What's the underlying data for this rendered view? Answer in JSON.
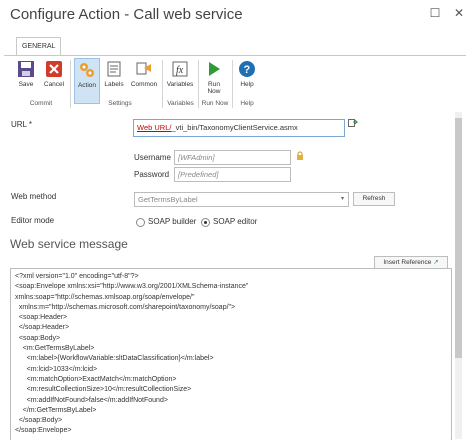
{
  "window": {
    "title": "Configure Action - Call web service",
    "maximize_glyph": "☐",
    "close_glyph": "✕"
  },
  "ribbon": {
    "tab": "GENERAL",
    "buttons": {
      "save": "Save",
      "cancel": "Cancel",
      "action": "Action",
      "labels": "Labels",
      "common": "Common",
      "variables": "Variables",
      "run_now_1": "Run",
      "run_now_2": "Now",
      "help": "Help"
    },
    "groups": {
      "commit": "Commit",
      "settings": "Settings",
      "variables": "Variables",
      "run_now": "Run Now",
      "help": "Help"
    }
  },
  "form": {
    "url_label": "URL *",
    "url_link": "Web URL/",
    "url_rest": "_vti_bin/TaxonomyClientService.asmx",
    "username_label": "Username",
    "username_value": "[WFAdmin]",
    "password_label": "Password",
    "password_value": "[Predefined]",
    "method_label": "Web method",
    "method_value": "GetTermsByLabel",
    "refresh_label": "Refresh",
    "editor_label": "Editor mode",
    "editor_options": [
      "SOAP builder",
      "SOAP editor"
    ],
    "editor_selected": "SOAP editor"
  },
  "message": {
    "heading": "Web service message",
    "insert_reference": "Insert Reference",
    "lines": [
      "<?xml version=\"1.0\" encoding=\"utf-8\"?>",
      "<soap:Envelope xmlns:xsi=\"http://www.w3.org/2001/XMLSchema-instance\"",
      "xmlns:soap=\"http://schemas.xmlsoap.org/soap/envelope/\"",
      "  xmlns:m=\"http://schemas.microsoft.com/sharepoint/taxonomy/soap/\">",
      "  <soap:Header>",
      "  </soap:Header>",
      "  <soap:Body>",
      "    <m:GetTermsByLabel>",
      "      <m:label>{WorkflowVariable:sltDataClassification}</m:label>",
      "      <m:lcid>1033</m:lcid>",
      "      <m:matchOption>ExactMatch</m:matchOption>",
      "      <m:resultCollectionSize>10</m:resultCollectionSize>",
      "      <m:addIfNotFound>false</m:addIfNotFound>",
      "    </m:GetTermsByLabel>",
      "  </soap:Body>",
      "</soap:Envelope>"
    ]
  }
}
